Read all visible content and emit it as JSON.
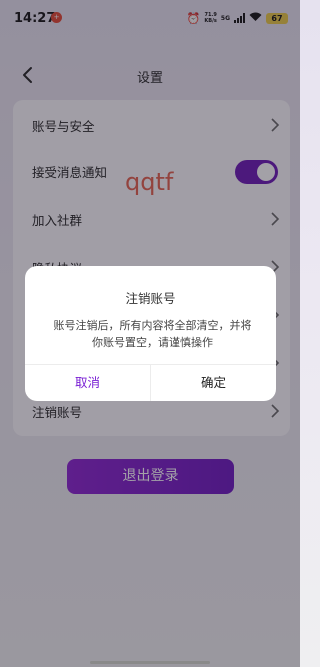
{
  "status_bar": {
    "time": "14:27",
    "app_badge": "+",
    "alarm_icon": "alarm-icon",
    "net_speed_value": "71.9",
    "net_speed_unit": "KB/s",
    "signal_label": "5G",
    "battery": "67"
  },
  "nav": {
    "title": "设置",
    "back_icon": "chevron-left-icon"
  },
  "settings": {
    "items": [
      {
        "label": "账号与安全"
      },
      {
        "label": "接受消息通知",
        "toggle_on": true
      },
      {
        "label": "加入社群"
      },
      {
        "label": "隐私协议"
      },
      {
        "label": ""
      },
      {
        "label": ""
      },
      {
        "label": "注销账号"
      }
    ]
  },
  "watermark": "qqtf",
  "logout_label": "退出登录",
  "dialog": {
    "title": "注销账号",
    "message": "账号注销后，所有内容将全部清空，并将你账号置空，请谨慎操作",
    "cancel_label": "取消",
    "confirm_label": "确定"
  },
  "colors": {
    "accent": "#6a15b5",
    "cancel_text": "#7a20d4",
    "watermark": "#e35d4a"
  }
}
